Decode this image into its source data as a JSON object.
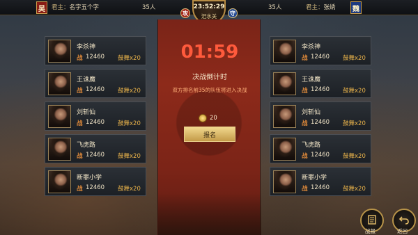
{
  "top": {
    "left_flag": "吴",
    "right_flag": "魏",
    "left_lord_prefix": "君主：",
    "left_lord_name": "名字五个字",
    "left_count": "35人",
    "right_count": "35人",
    "right_lord_prefix": "君主：",
    "right_lord_name": "张绣",
    "time": "23:52:29",
    "pass_name": "汜水关",
    "attack_badge": "攻",
    "defend_badge": "守"
  },
  "left_players": [
    {
      "name": "李杀神",
      "war_label": "战",
      "power": "12460",
      "drum": "鼓舞x20"
    },
    {
      "name": "王诛魔",
      "war_label": "战",
      "power": "12460",
      "drum": "鼓舞x20"
    },
    {
      "name": "刘斩仙",
      "war_label": "战",
      "power": "12460",
      "drum": "鼓舞x20"
    },
    {
      "name": "飞虎路",
      "war_label": "战",
      "power": "12460",
      "drum": "鼓舞x20"
    },
    {
      "name": "断罪小学",
      "war_label": "战",
      "power": "12460",
      "drum": "鼓舞x20"
    }
  ],
  "right_players": [
    {
      "name": "李杀神",
      "war_label": "战",
      "power": "12460",
      "drum": "鼓舞x20"
    },
    {
      "name": "王诛魔",
      "war_label": "战",
      "power": "12460",
      "drum": "鼓舞x20"
    },
    {
      "name": "刘斩仙",
      "war_label": "战",
      "power": "12460",
      "drum": "鼓舞x20"
    },
    {
      "name": "飞虎路",
      "war_label": "战",
      "power": "12460",
      "drum": "鼓舞x20"
    },
    {
      "name": "断罪小学",
      "war_label": "战",
      "power": "12460",
      "drum": "鼓舞x20"
    }
  ],
  "center": {
    "countdown": "01:59",
    "title": "决战倒计时",
    "note": "双方排名前35的队伍将进入决战",
    "cost": "20",
    "signup_label": "报名"
  },
  "buttons": {
    "report_label": "战报",
    "return_label": "返回"
  },
  "colors": {
    "accent_gold": "#c89c4a",
    "countdown_red": "#ff5a3c",
    "drum_gold": "#e8b24a"
  },
  "icons": {
    "report": "scroll-icon",
    "return": "return-arrow-icon",
    "cost": "coin-icon"
  }
}
